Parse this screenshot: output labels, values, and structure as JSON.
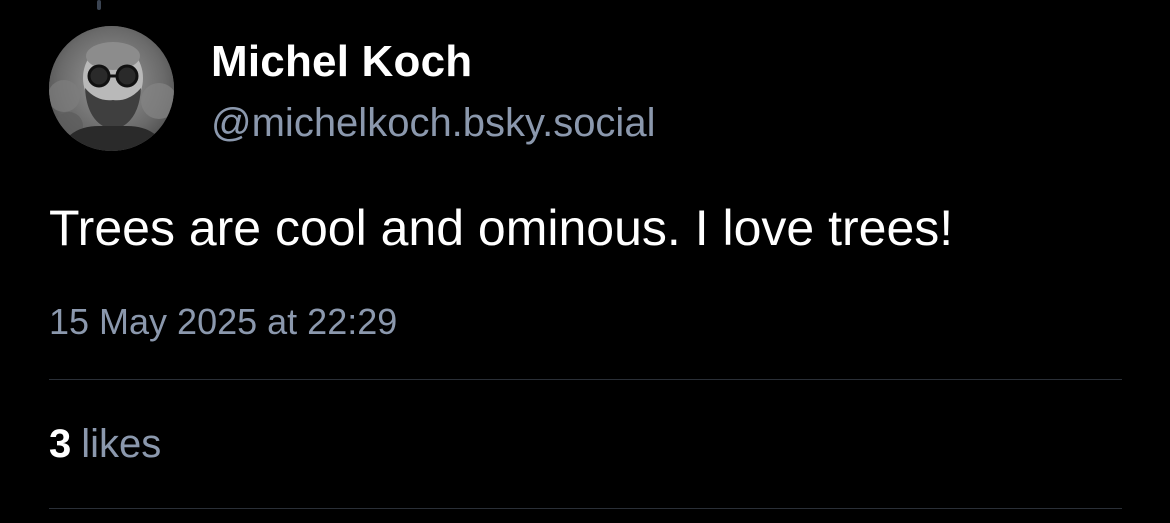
{
  "post": {
    "author": {
      "display_name": "Michel Koch",
      "handle": "@michelkoch.bsky.social"
    },
    "text": "Trees are cool and ominous. I love trees!",
    "timestamp": "15 May 2025 at 22:29",
    "likes": {
      "count": "3",
      "label": "likes"
    }
  },
  "colors": {
    "background": "#000000",
    "primary_text": "#ffffff",
    "secondary_text": "#8b98ad",
    "divider": "#2a2f37"
  }
}
